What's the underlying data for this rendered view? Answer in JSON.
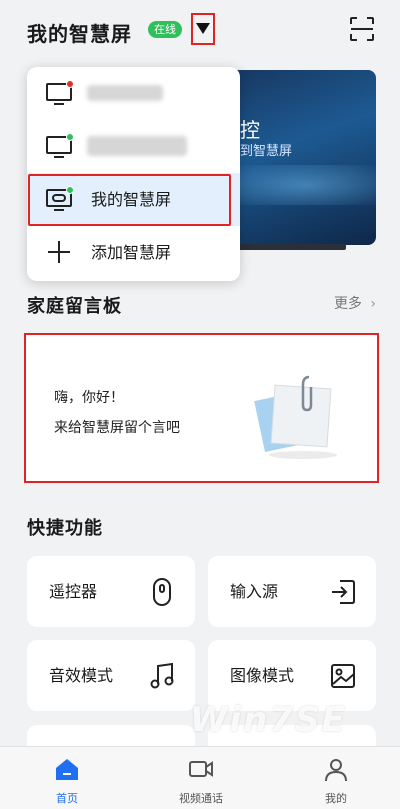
{
  "header": {
    "title": "我的智慧屏",
    "status_badge": "在线"
  },
  "tv_preview": {
    "text_main": "控",
    "text_sub": "到智慧屏"
  },
  "device_menu": {
    "items": [
      {
        "label": "",
        "status": "offline",
        "status_color": "#e0302a"
      },
      {
        "label": "",
        "status": "online",
        "status_color": "#2fbf5b"
      },
      {
        "label": "我的智慧屏",
        "status": "online",
        "status_color": "#2fbf5b",
        "selected": true
      },
      {
        "label": "添加智慧屏"
      }
    ]
  },
  "message_board": {
    "title": "家庭留言板",
    "more_label": "更多",
    "line1": "嗨，你好！",
    "line2": "来给智慧屏留个言吧"
  },
  "shortcuts": {
    "title": "快捷功能",
    "items": [
      {
        "label": "遥控器",
        "icon": "remote-icon"
      },
      {
        "label": "输入源",
        "icon": "input-source-icon"
      },
      {
        "label": "音效模式",
        "icon": "music-note-icon"
      },
      {
        "label": "图像模式",
        "icon": "image-icon"
      }
    ]
  },
  "bottom_nav": {
    "tabs": [
      {
        "label": "首页",
        "icon": "home-icon",
        "active": true
      },
      {
        "label": "视频通话",
        "icon": "video-call-icon"
      },
      {
        "label": "我的",
        "icon": "profile-icon"
      }
    ]
  },
  "colors": {
    "accent": "#1f6ff0",
    "online": "#2fbf5b",
    "offline": "#e0302a",
    "annotation": "#e02424"
  },
  "watermark": "Win7SE"
}
